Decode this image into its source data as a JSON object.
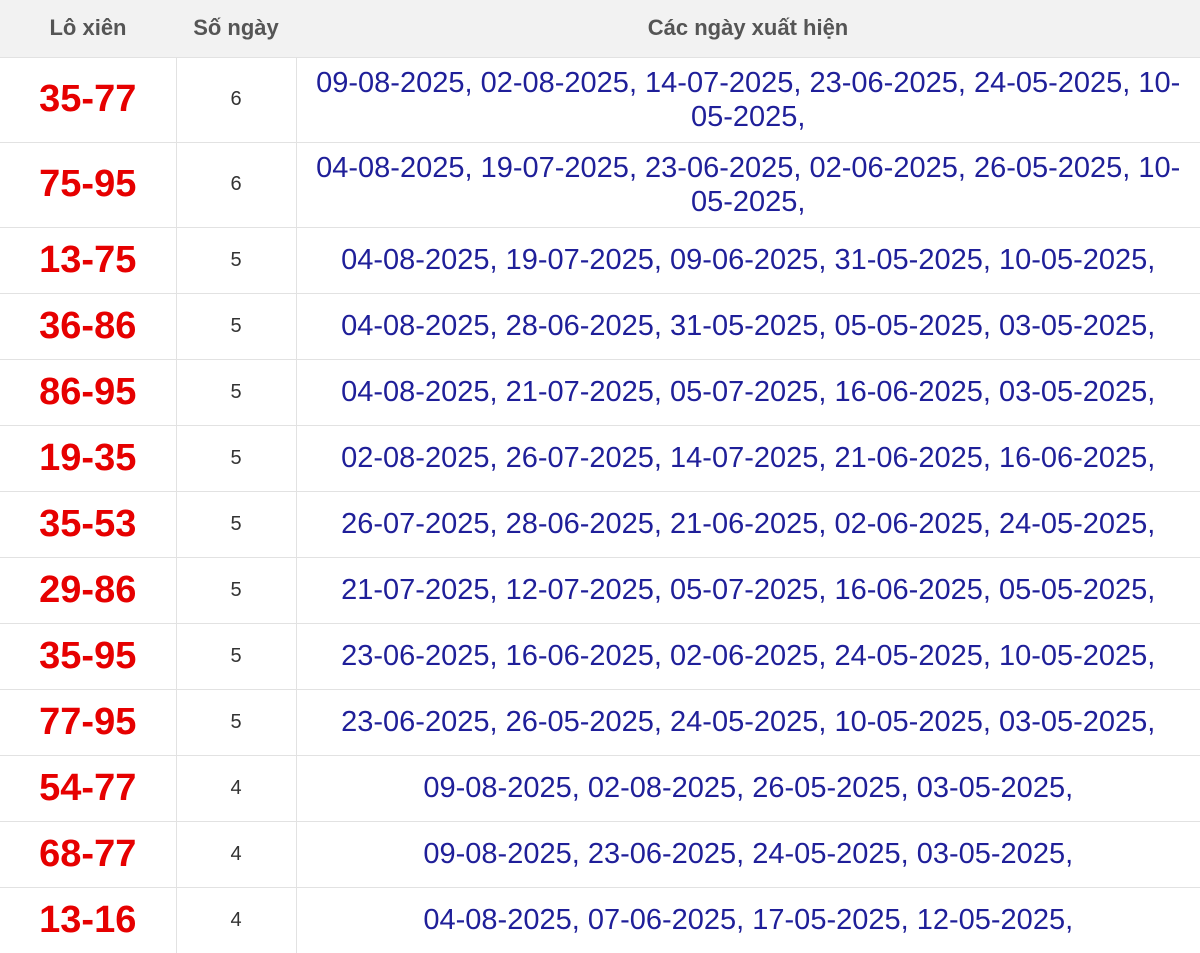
{
  "header": {
    "col_pair": "Lô xiên",
    "col_count": "Số ngày",
    "col_dates": "Các ngày xuất hiện"
  },
  "rows": [
    {
      "pair": "35-77",
      "count": "6",
      "dates": "09-08-2025, 02-08-2025, 14-07-2025, 23-06-2025, 24-05-2025, 10-05-2025,"
    },
    {
      "pair": "75-95",
      "count": "6",
      "dates": "04-08-2025, 19-07-2025, 23-06-2025, 02-06-2025, 26-05-2025, 10-05-2025,"
    },
    {
      "pair": "13-75",
      "count": "5",
      "dates": "04-08-2025, 19-07-2025, 09-06-2025, 31-05-2025, 10-05-2025,"
    },
    {
      "pair": "36-86",
      "count": "5",
      "dates": "04-08-2025, 28-06-2025, 31-05-2025, 05-05-2025, 03-05-2025,"
    },
    {
      "pair": "86-95",
      "count": "5",
      "dates": "04-08-2025, 21-07-2025, 05-07-2025, 16-06-2025, 03-05-2025,"
    },
    {
      "pair": "19-35",
      "count": "5",
      "dates": "02-08-2025, 26-07-2025, 14-07-2025, 21-06-2025, 16-06-2025,"
    },
    {
      "pair": "35-53",
      "count": "5",
      "dates": "26-07-2025, 28-06-2025, 21-06-2025, 02-06-2025, 24-05-2025,"
    },
    {
      "pair": "29-86",
      "count": "5",
      "dates": "21-07-2025, 12-07-2025, 05-07-2025, 16-06-2025, 05-05-2025,"
    },
    {
      "pair": "35-95",
      "count": "5",
      "dates": "23-06-2025, 16-06-2025, 02-06-2025, 24-05-2025, 10-05-2025,"
    },
    {
      "pair": "77-95",
      "count": "5",
      "dates": "23-06-2025, 26-05-2025, 24-05-2025, 10-05-2025, 03-05-2025,"
    },
    {
      "pair": "54-77",
      "count": "4",
      "dates": "09-08-2025, 02-08-2025, 26-05-2025, 03-05-2025,"
    },
    {
      "pair": "68-77",
      "count": "4",
      "dates": "09-08-2025, 23-06-2025, 24-05-2025, 03-05-2025,"
    },
    {
      "pair": "13-16",
      "count": "4",
      "dates": "04-08-2025, 07-06-2025, 17-05-2025, 12-05-2025,"
    }
  ],
  "colors": {
    "pair": "#e60000",
    "dates": "#1f1f99",
    "header_bg": "#f2f2f2"
  }
}
